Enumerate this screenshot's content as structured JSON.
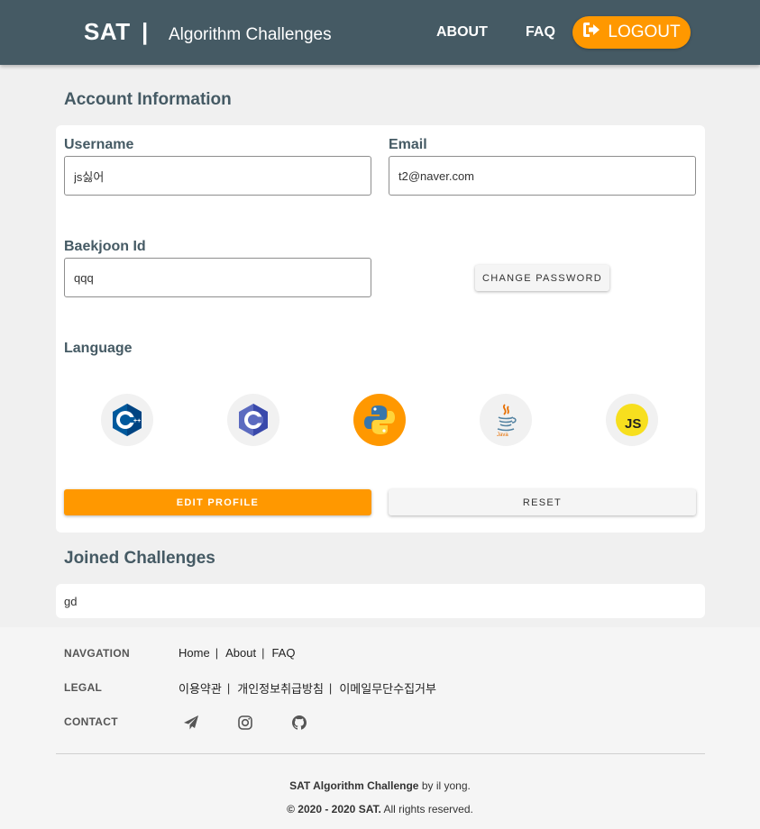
{
  "header": {
    "brand": "SAT",
    "separator": "|",
    "subtitle": "Algorithm Challenges",
    "nav": {
      "about": "ABOUT",
      "faq": "FAQ",
      "logout": "LOGOUT"
    },
    "accent_color": "#ff9800",
    "bar_color": "#455a64"
  },
  "account": {
    "title": "Account Information",
    "username": {
      "label": "Username",
      "value": "js싫어"
    },
    "email": {
      "label": "Email",
      "value": "t2@naver.com"
    },
    "baekjoon": {
      "label": "Baekjoon Id",
      "value": "qqq"
    },
    "change_password_label": "CHANGE PASSWORD",
    "language": {
      "label": "Language",
      "options": [
        {
          "name": "C++",
          "icon": "cpp-icon",
          "selected": false
        },
        {
          "name": "C",
          "icon": "c-icon",
          "selected": false
        },
        {
          "name": "Python",
          "icon": "python-icon",
          "selected": true
        },
        {
          "name": "Java",
          "icon": "java-icon",
          "selected": false
        },
        {
          "name": "JavaScript",
          "icon": "javascript-icon",
          "selected": false
        }
      ]
    },
    "edit_profile_label": "EDIT PROFILE",
    "reset_label": "RESET"
  },
  "joined": {
    "title": "Joined Challenges",
    "items": [
      "gd"
    ]
  },
  "footer": {
    "navigation": {
      "label": "NAVGATION",
      "links": [
        "Home",
        "About",
        "FAQ"
      ]
    },
    "legal": {
      "label": "LEGAL",
      "links": [
        "이용약관",
        "개인정보취급방침",
        "이메일무단수집거부"
      ]
    },
    "contact": {
      "label": "CONTACT",
      "icons": [
        "paper-plane-icon",
        "instagram-icon",
        "github-icon"
      ]
    },
    "credit_bold": "SAT Algorithm Challenge",
    "credit_rest": " by il yong.",
    "copyright_bold": "© 2020 - 2020 SAT.",
    "copyright_rest": " All rights reserved."
  }
}
